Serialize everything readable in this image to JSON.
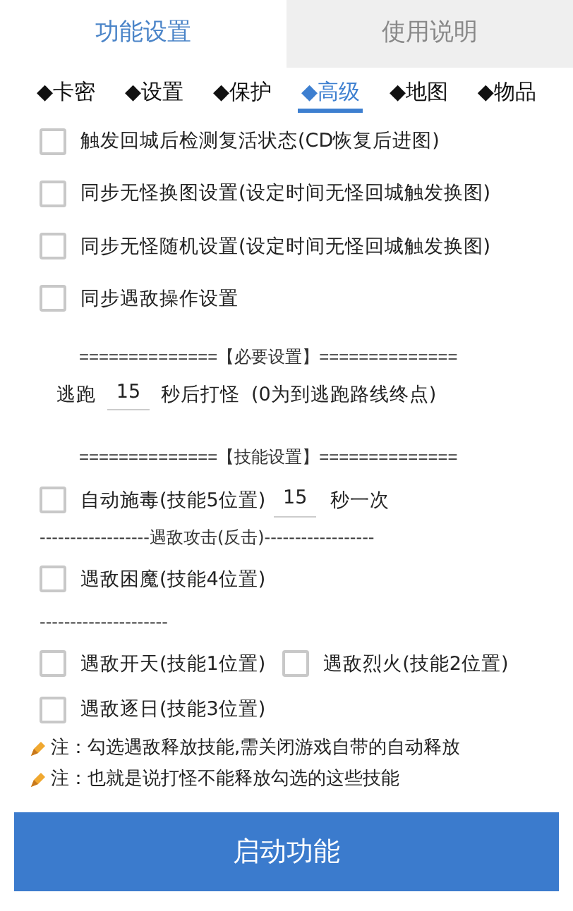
{
  "main_tabs": [
    {
      "label": "功能设置",
      "selected": true
    },
    {
      "label": "使用说明",
      "selected": false
    }
  ],
  "sub_tabs": [
    {
      "label": "◆卡密",
      "selected": false
    },
    {
      "label": "◆设置",
      "selected": false
    },
    {
      "label": "◆保护",
      "selected": false
    },
    {
      "label": "◆高级",
      "selected": true
    },
    {
      "label": "◆地图",
      "selected": false
    },
    {
      "label": "◆物品",
      "selected": false
    }
  ],
  "options": [
    {
      "label": "触发回城后检测复活状态(CD恢复后进图)",
      "checked": false
    },
    {
      "label": "同步无怪换图设置(设定时间无怪回城触发换图)",
      "checked": false
    },
    {
      "label": "同步无怪随机设置(设定时间无怪回城触发换图)",
      "checked": false
    },
    {
      "label": "同步遇敌操作设置",
      "checked": false
    }
  ],
  "required_section": {
    "header": "==============【必要设置】==============",
    "prefix": "逃跑",
    "value": "15",
    "suffix": "秒后打怪",
    "hint": "(0为到逃跑路线终点)"
  },
  "skill_section": {
    "header": "==============【技能设置】==============",
    "auto_poison": {
      "label": "自动施毒(技能5位置)",
      "checked": false,
      "value": "15",
      "suffix": "秒一次"
    },
    "items": [
      {
        "kind": "divider",
        "text": "------------------遇敌攻击(反击)------------------"
      },
      {
        "kind": "checks",
        "checks": [
          {
            "label": "遇敌困魔(技能4位置)",
            "checked": false
          }
        ]
      },
      {
        "kind": "divider",
        "text": "---------------------"
      },
      {
        "kind": "checks",
        "checks": [
          {
            "label": "遇敌开天(技能1位置)",
            "checked": false
          },
          {
            "label": "遇敌烈火(技能2位置)",
            "checked": false
          }
        ]
      },
      {
        "kind": "checks",
        "checks": [
          {
            "label": "遇敌逐日(技能3位置)",
            "checked": false
          }
        ]
      }
    ]
  },
  "notes": [
    "注：勾选遇敌释放技能,需关闭游戏自带的自动释放",
    "注：也就是说打怪不能释放勾选的这些技能"
  ],
  "start_button": "启动功能"
}
